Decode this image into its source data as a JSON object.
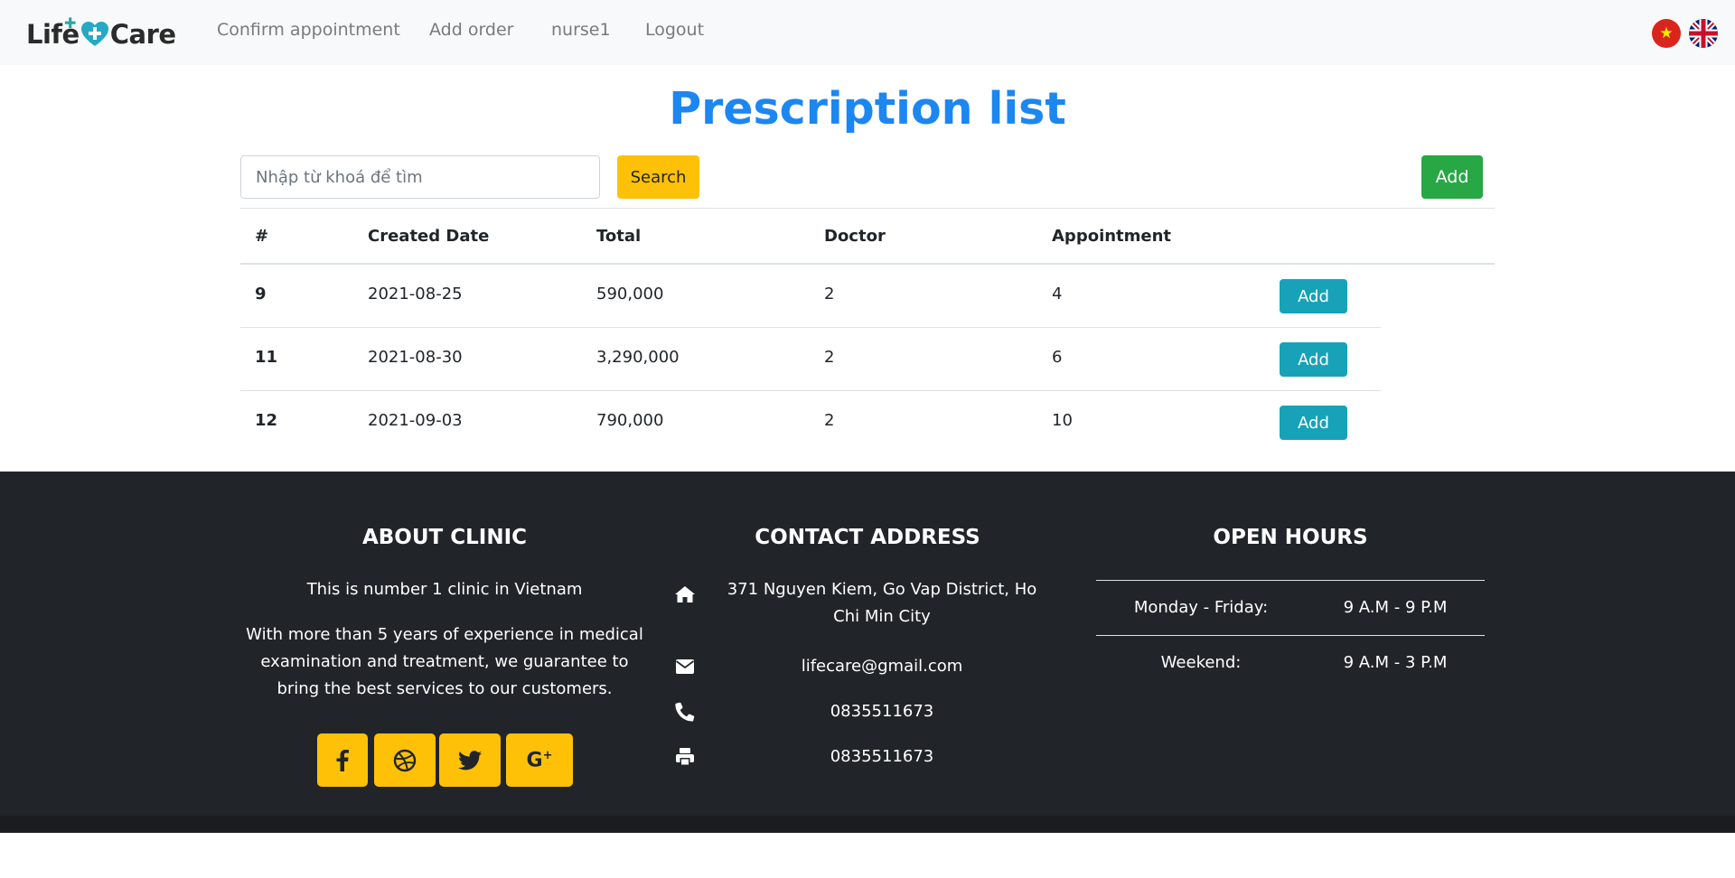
{
  "nav": {
    "brand_left": "Life",
    "brand_right": "Care",
    "links": [
      "Confirm appointment",
      "Add order",
      "nurse1",
      "Logout"
    ],
    "flags": [
      "vietnam-flag-icon",
      "uk-flag-icon"
    ]
  },
  "page": {
    "title": "Prescription list",
    "search_placeholder": "Nhập từ khoá để tìm",
    "search_label": "Search",
    "add_label": "Add"
  },
  "table": {
    "headers": [
      "#",
      "Created Date",
      "Total",
      "Doctor",
      "Appointment"
    ],
    "rows": [
      {
        "id": "9",
        "date": "2021-08-25",
        "total": "590,000",
        "doctor": "2",
        "appointment": "4",
        "action": "Add"
      },
      {
        "id": "11",
        "date": "2021-08-30",
        "total": "3,290,000",
        "doctor": "2",
        "appointment": "6",
        "action": "Add"
      },
      {
        "id": "12",
        "date": "2021-09-03",
        "total": "790,000",
        "doctor": "2",
        "appointment": "10",
        "action": "Add"
      }
    ]
  },
  "footer": {
    "about": {
      "title": "ABOUT CLINIC",
      "line1": "This is number 1 clinic in Vietnam",
      "line2": "With more than 5 years of experience in medical examination and treatment, we guarantee to bring the best services to our customers.",
      "socials": [
        "facebook-icon",
        "dribbble-icon",
        "twitter-icon",
        "google-plus-icon"
      ]
    },
    "contact": {
      "title": "CONTACT ADDRESS",
      "address": "371 Nguyen Kiem, Go Vap District, Ho Chi Min City",
      "email": "lifecare@gmail.com",
      "phone": "0835511673",
      "fax": "0835511673"
    },
    "hours": {
      "title": "OPEN HOURS",
      "weekday_label": "Monday - Friday:",
      "weekday_time": "9 A.M - 9 P.M",
      "weekend_label": "Weekend:",
      "weekend_time": "9 A.M - 3 P.M"
    }
  },
  "colors": {
    "title_blue": "#1c86f1",
    "search_yellow": "#ffc107",
    "add_green": "#28a745",
    "row_button_teal": "#17a2b8",
    "footer_dark": "#212529"
  }
}
